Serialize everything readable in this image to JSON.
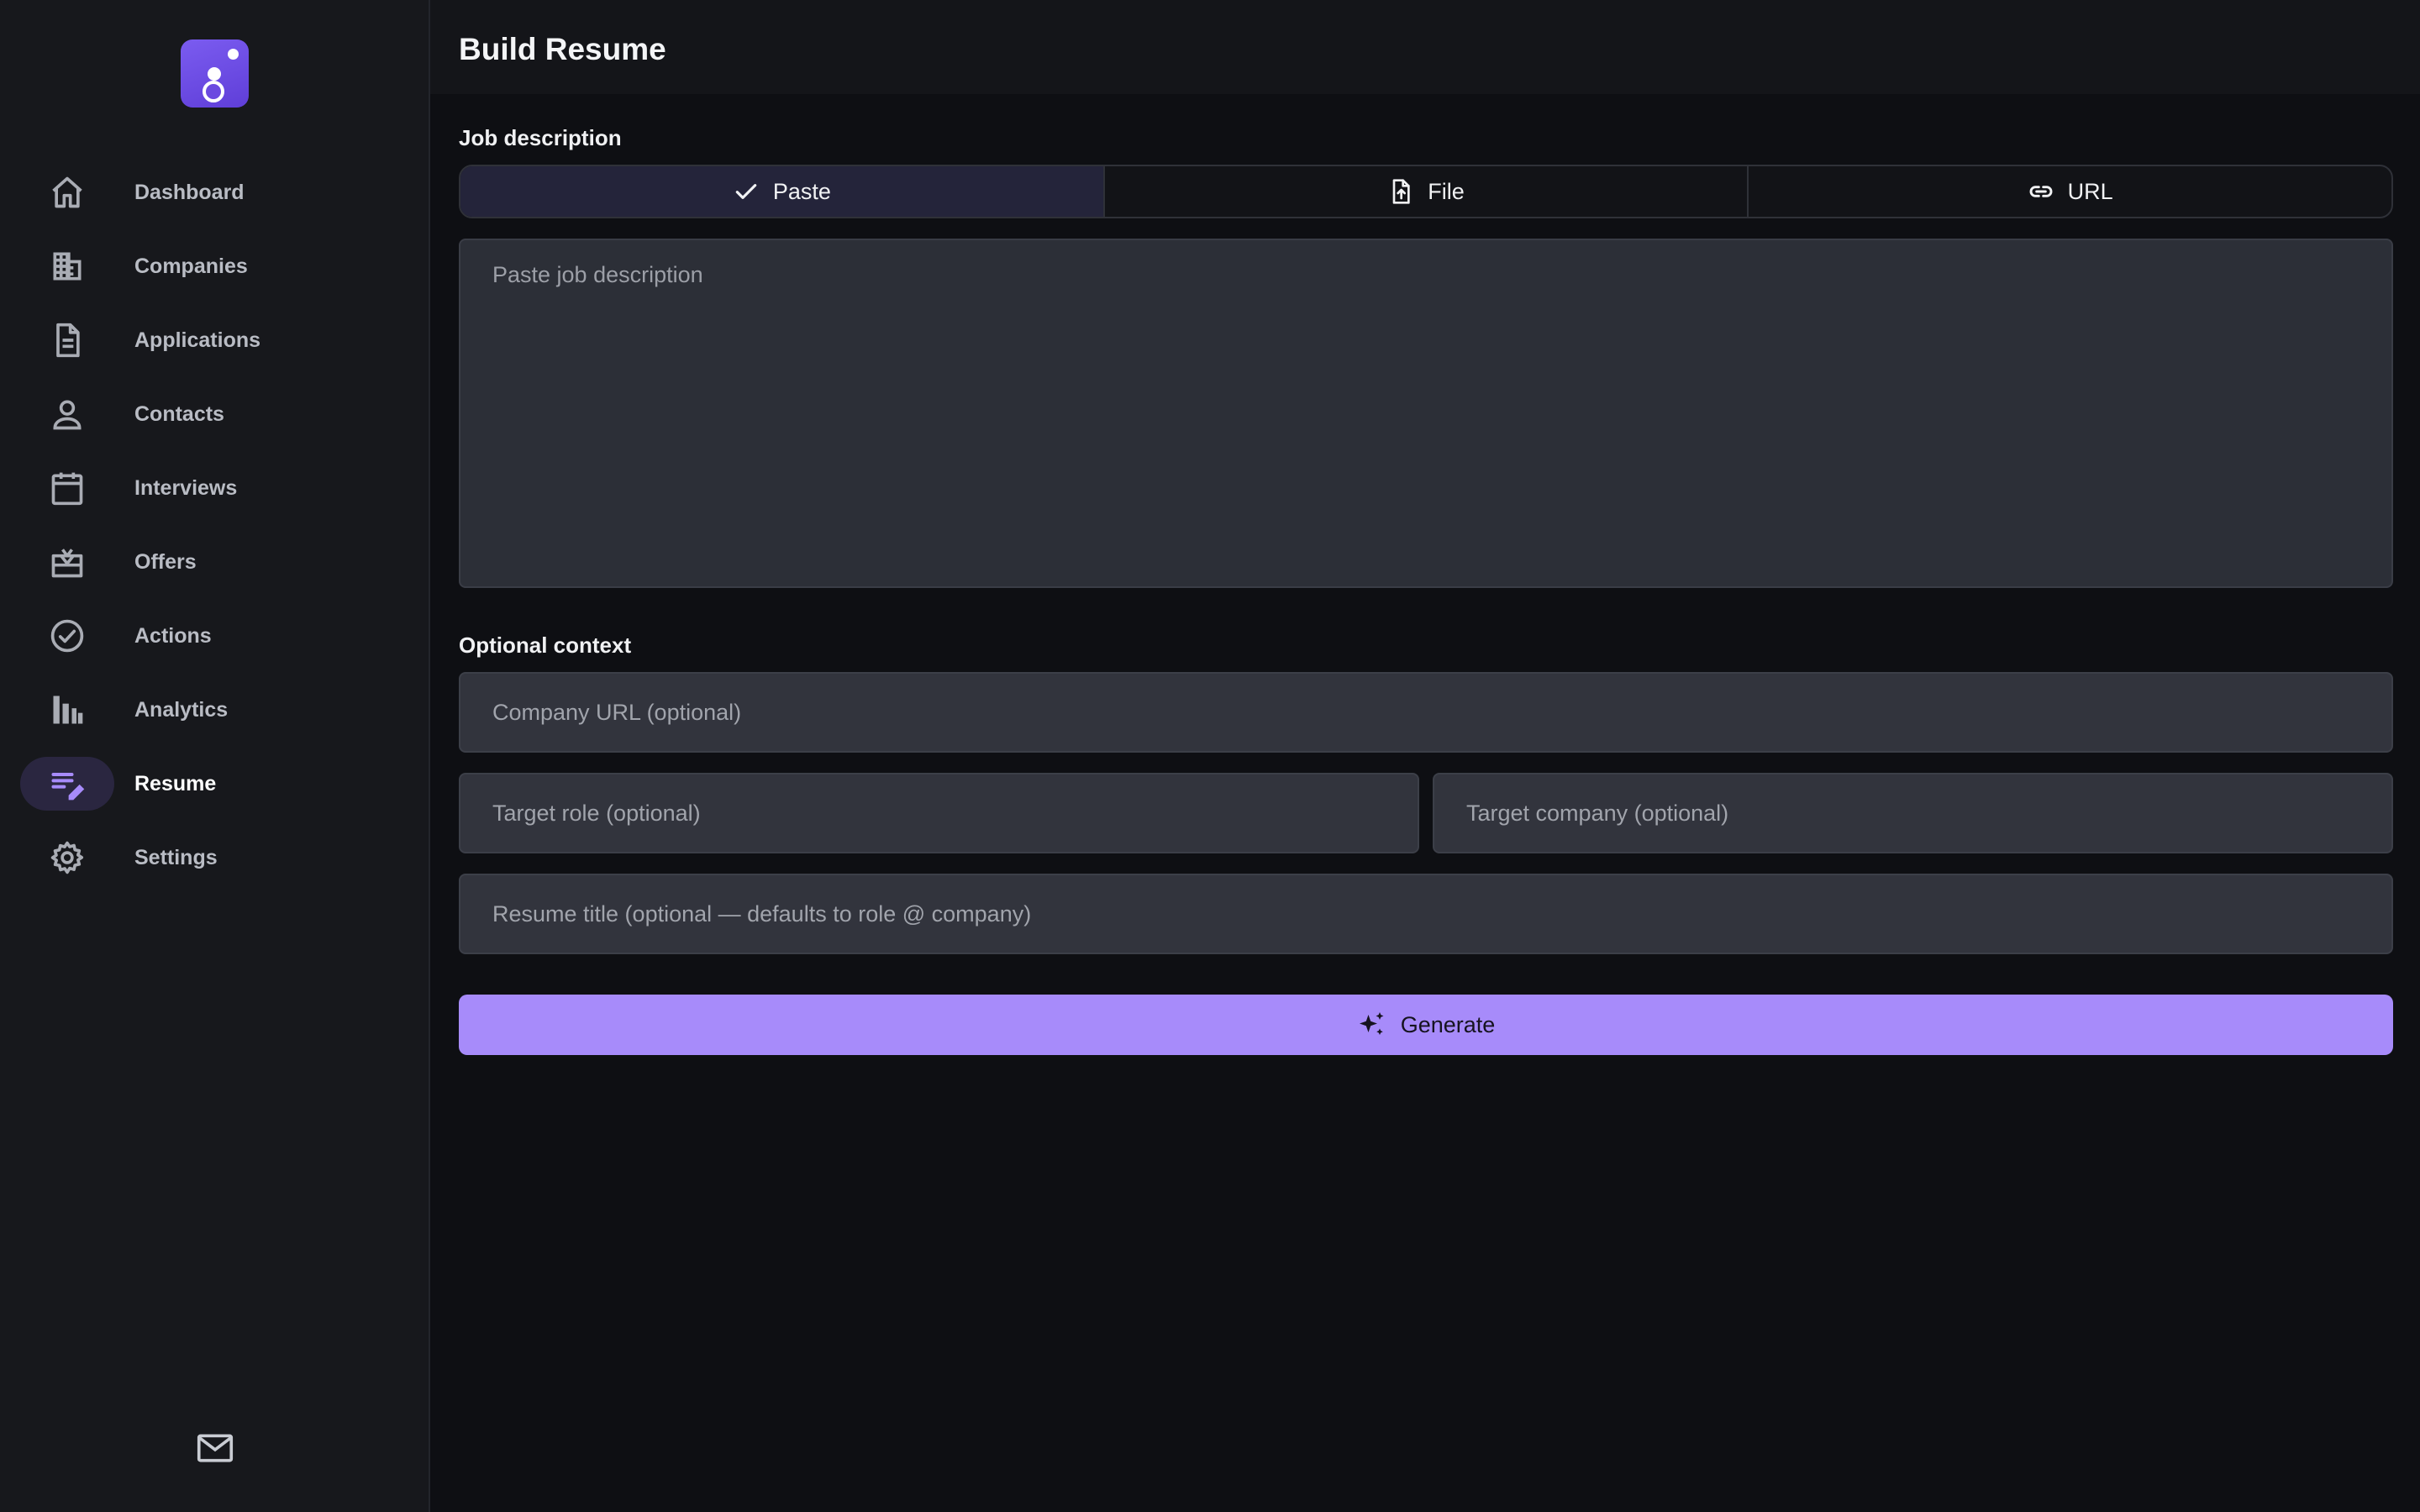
{
  "header": {
    "title": "Build Resume"
  },
  "sidebar": {
    "items": [
      {
        "label": "Dashboard",
        "icon": "home-icon"
      },
      {
        "label": "Companies",
        "icon": "building-icon"
      },
      {
        "label": "Applications",
        "icon": "document-icon"
      },
      {
        "label": "Contacts",
        "icon": "person-icon"
      },
      {
        "label": "Interviews",
        "icon": "calendar-icon"
      },
      {
        "label": "Offers",
        "icon": "gift-icon"
      },
      {
        "label": "Actions",
        "icon": "check-circle-icon"
      },
      {
        "label": "Analytics",
        "icon": "bar-chart-icon"
      },
      {
        "label": "Resume",
        "icon": "edit-note-icon",
        "active": true
      },
      {
        "label": "Settings",
        "icon": "gear-icon"
      }
    ],
    "footer_icon": "mail-icon"
  },
  "job_description": {
    "label": "Job description",
    "tabs": [
      {
        "label": "Paste",
        "icon": "check-icon",
        "active": true
      },
      {
        "label": "File",
        "icon": "file-upload-icon"
      },
      {
        "label": "URL",
        "icon": "link-icon"
      }
    ],
    "textarea_placeholder": "Paste job description"
  },
  "optional_context": {
    "label": "Optional context",
    "company_url_placeholder": "Company URL (optional)",
    "target_role_placeholder": "Target role (optional)",
    "target_company_placeholder": "Target company (optional)",
    "resume_title_placeholder": "Resume title (optional — defaults to role @ company)"
  },
  "generate_button": {
    "label": "Generate",
    "icon": "sparkles-icon"
  },
  "colors": {
    "accent": "#a78bfa",
    "brand": "#6b4ae0",
    "background": "#0e0f13",
    "sidebar": "#17181c"
  }
}
